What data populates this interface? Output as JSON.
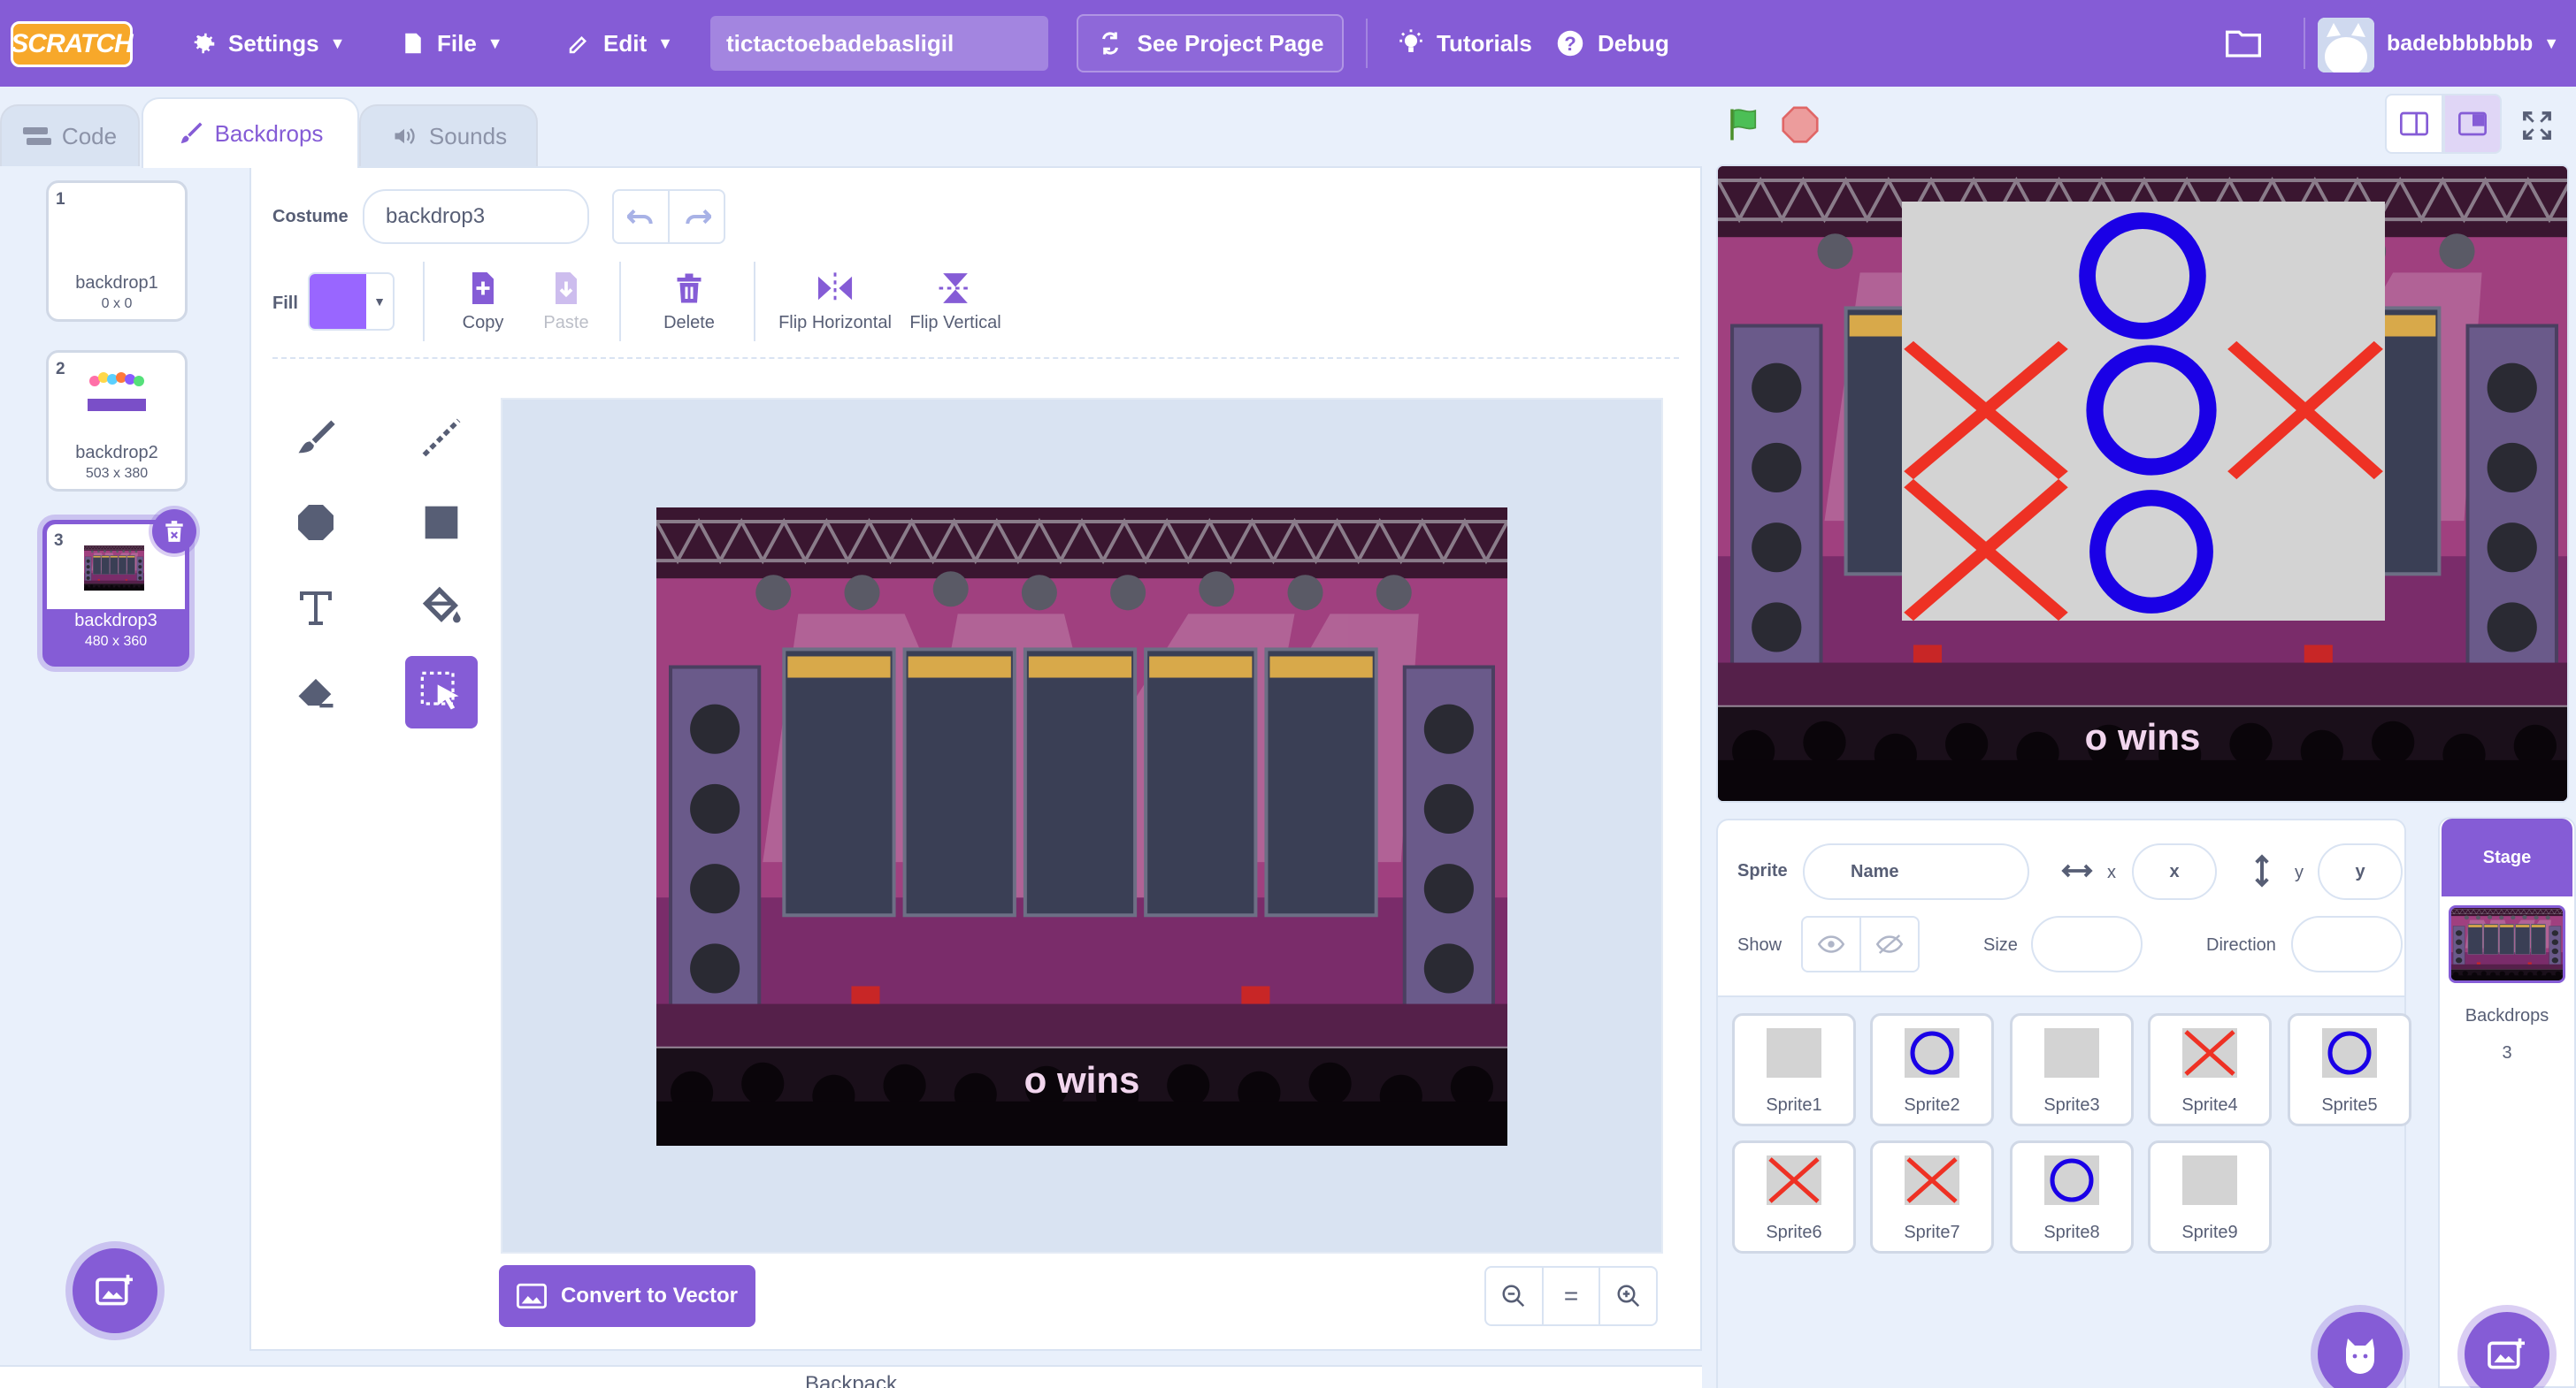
{
  "menubar": {
    "logo": "SCRATCH",
    "settings": "Settings",
    "file": "File",
    "edit": "Edit",
    "project_title": "tictactoebadebasligil",
    "see_project_page": "See Project Page",
    "tutorials": "Tutorials",
    "debug": "Debug",
    "username": "badebbbbbbb"
  },
  "tabs": {
    "code": "Code",
    "backdrops": "Backdrops",
    "sounds": "Sounds"
  },
  "costumes": [
    {
      "num": "1",
      "name": "backdrop1",
      "size": "0 x 0"
    },
    {
      "num": "2",
      "name": "backdrop2",
      "size": "503 x 380"
    },
    {
      "num": "3",
      "name": "backdrop3",
      "size": "480 x 360"
    }
  ],
  "editor": {
    "costume_label": "Costume",
    "costume_name": "backdrop3",
    "fill_label": "Fill",
    "fill_color": "#9966ff",
    "copy": "Copy",
    "paste": "Paste",
    "delete": "Delete",
    "flip_horizontal": "Flip Horizontal",
    "flip_vertical": "Flip Vertical",
    "convert": "Convert to Vector",
    "zoom_reset": "="
  },
  "stage_text": "o wins",
  "backpack": "Backpack",
  "sprite_info": {
    "sprite_label": "Sprite",
    "name_placeholder": "Name",
    "x_label": "x",
    "x_placeholder": "x",
    "y_label": "y",
    "y_placeholder": "y",
    "show_label": "Show",
    "size_label": "Size",
    "direction_label": "Direction"
  },
  "sprites": [
    {
      "name": "Sprite1",
      "icon": "gray-square"
    },
    {
      "name": "Sprite2",
      "icon": "o-mark"
    },
    {
      "name": "Sprite3",
      "icon": "gray-square"
    },
    {
      "name": "Sprite4",
      "icon": "x-mark"
    },
    {
      "name": "Sprite5",
      "icon": "o-mark"
    },
    {
      "name": "Sprite6",
      "icon": "x-mark"
    },
    {
      "name": "Sprite7",
      "icon": "x-mark"
    },
    {
      "name": "Sprite8",
      "icon": "o-mark"
    },
    {
      "name": "Sprite9",
      "icon": "gray-square"
    }
  ],
  "stage_pane": {
    "title": "Stage",
    "backdrops_label": "Backdrops",
    "backdrops_count": "3"
  },
  "colors": {
    "accent": "#855cd6",
    "x_red": "#ee3124",
    "o_blue": "#1a00e6"
  }
}
